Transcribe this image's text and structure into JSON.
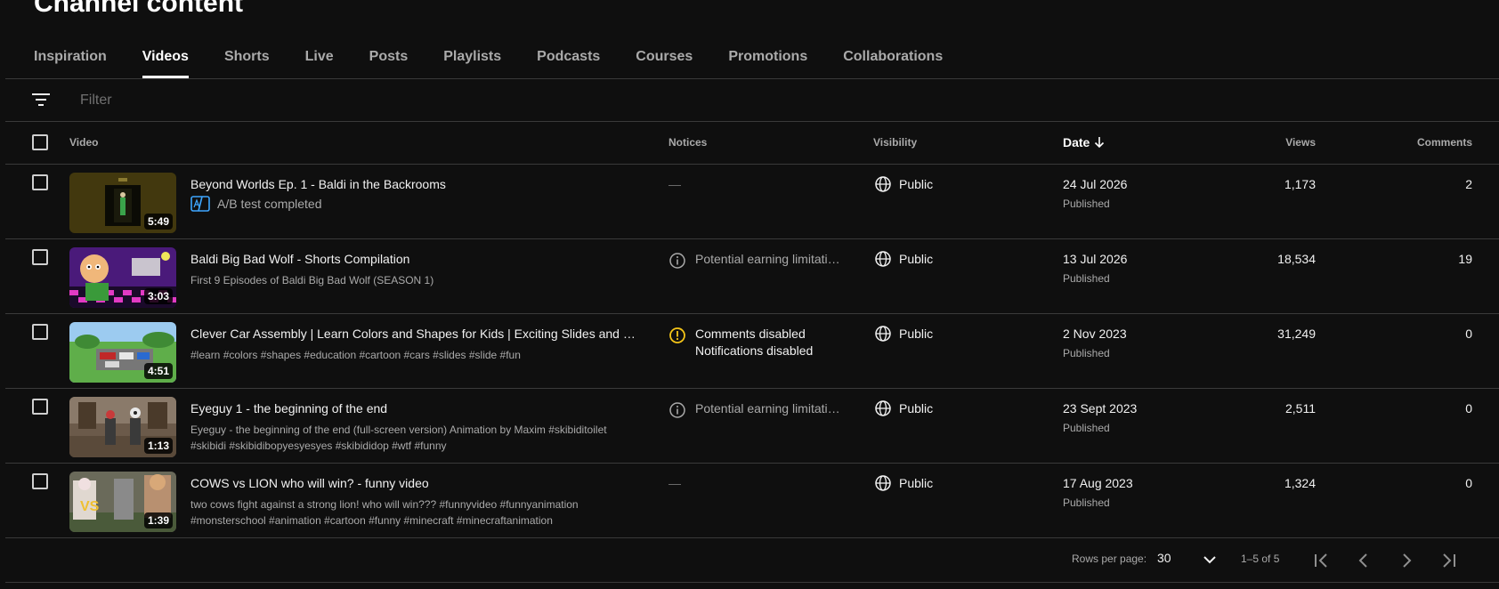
{
  "page": {
    "title": "Channel content"
  },
  "tabs": [
    {
      "label": "Inspiration"
    },
    {
      "label": "Videos"
    },
    {
      "label": "Shorts"
    },
    {
      "label": "Live"
    },
    {
      "label": "Posts"
    },
    {
      "label": "Playlists"
    },
    {
      "label": "Podcasts"
    },
    {
      "label": "Courses"
    },
    {
      "label": "Promotions"
    },
    {
      "label": "Collaborations"
    }
  ],
  "active_tab": "Videos",
  "filter": {
    "placeholder": "Filter",
    "icon": "filter-icon"
  },
  "columns": {
    "video": "Video",
    "notices": "Notices",
    "visibility": "Visibility",
    "date": "Date",
    "views": "Views",
    "comments": "Comments"
  },
  "videos": [
    {
      "title": "Beyond Worlds Ep. 1 - Baldi in the Backrooms",
      "duration": "5:49",
      "ab_test": "A/B test completed",
      "notice": "—",
      "visibility": "Public",
      "date": "24 Jul 2026",
      "status": "Published",
      "views": "1,173",
      "comments": "2"
    },
    {
      "title": "Baldi Big Bad Wolf - Shorts Compilation",
      "description": "First 9 Episodes of Baldi Big Bad Wolf (SEASON 1)",
      "duration": "3:03",
      "notice": "Potential earning limitati…",
      "visibility": "Public",
      "date": "13 Jul 2026",
      "status": "Published",
      "views": "18,534",
      "comments": "19"
    },
    {
      "title": "Clever Car Assembly | Learn Colors and Shapes for Kids | Exciting Slides and Mo…",
      "description": "#learn #colors #shapes #education #cartoon #cars #slides #slide #fun",
      "duration": "4:51",
      "notice_lines": [
        "Comments disabled",
        "Notifications disabled"
      ],
      "visibility": "Public",
      "date": "2 Nov 2023",
      "status": "Published",
      "views": "31,249",
      "comments": "0"
    },
    {
      "title": "Eyeguy 1 - the beginning of the end",
      "description_lines": [
        "Eyeguy - the beginning of the end (full-screen version) Animation by Maxim #skibiditoilet",
        "#skibidi #skibidibopyesyesyes #skibididop #wtf #funny"
      ],
      "duration": "1:13",
      "notice": "Potential earning limitati…",
      "visibility": "Public",
      "date": "23 Sept 2023",
      "status": "Published",
      "views": "2,511",
      "comments": "0"
    },
    {
      "title": "COWS vs LION who will win? - funny video",
      "description_lines": [
        "two cows fight against a strong lion! who will win??? #funnyvideo #funnyanimation",
        "#monsterschool #animation #cartoon #funny #minecraft #minecraftanimation"
      ],
      "duration": "1:39",
      "notice": "—",
      "visibility": "Public",
      "date": "17 Aug 2023",
      "status": "Published",
      "views": "1,324",
      "comments": "0"
    }
  ],
  "pagination": {
    "rows_per_page_label": "Rows per page:",
    "rows_per_page": "30",
    "range": "1–5 of 5"
  },
  "colors": {
    "background": "#0f0f0f",
    "divider": "#3a3a3a",
    "warning": "#f5c518",
    "ab_test": "#3ea6ff"
  }
}
